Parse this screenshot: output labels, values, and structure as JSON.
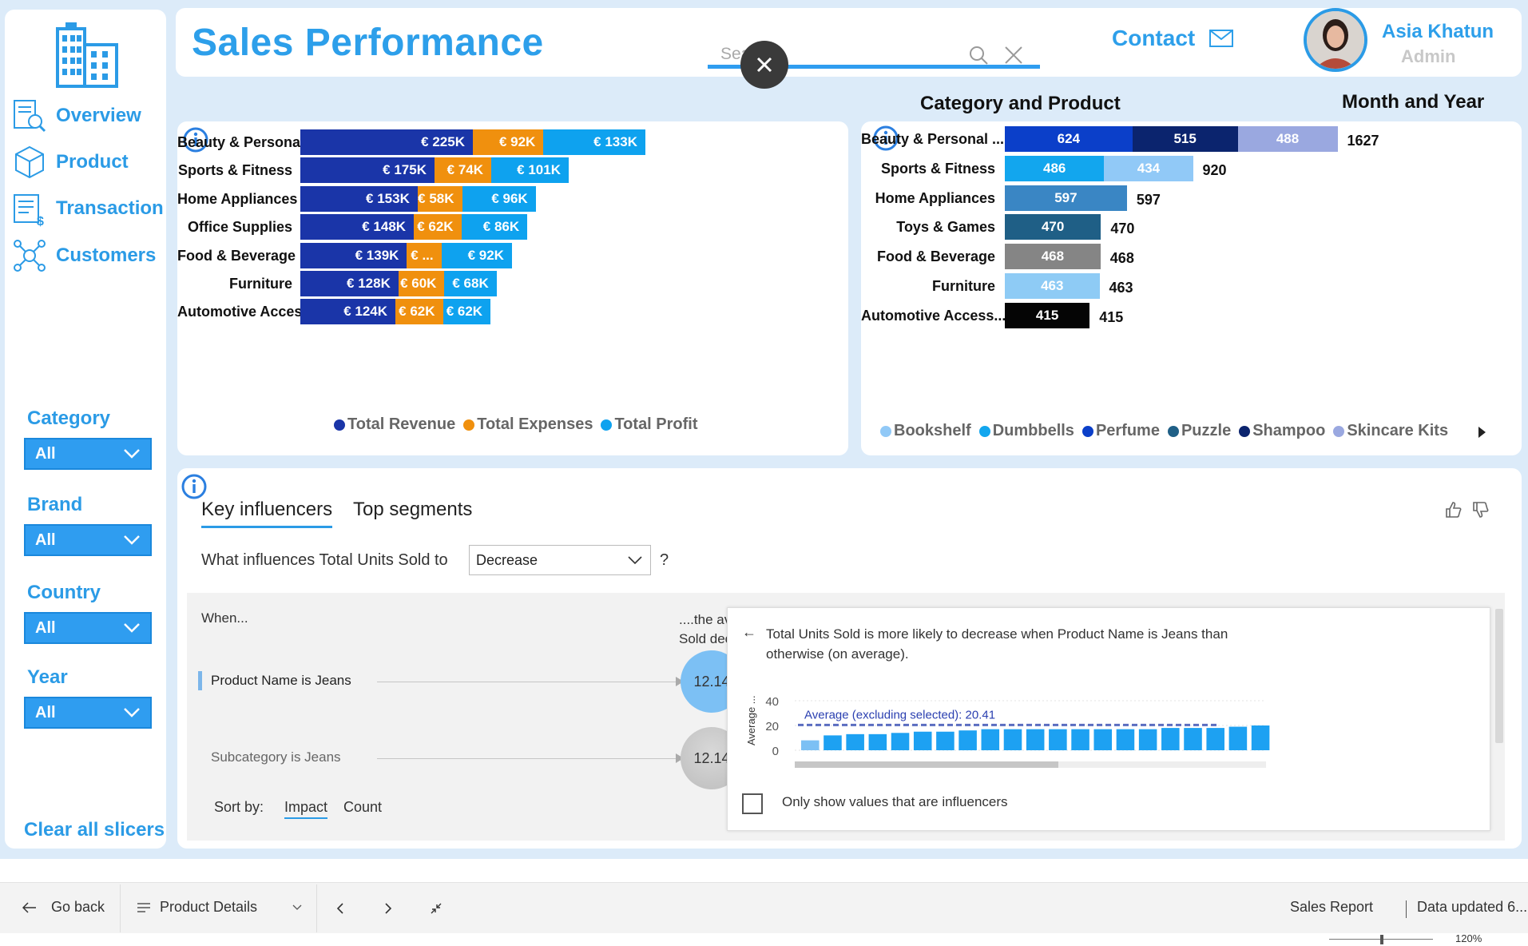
{
  "header": {
    "title": "Sales Performance",
    "search_placeholder": "Search",
    "contact_label": "Contact",
    "user_name": "Asia Khatun",
    "user_role": "Admin"
  },
  "nav": [
    {
      "label": "Overview",
      "icon": "report-search-icon"
    },
    {
      "label": "Product",
      "icon": "box-icon"
    },
    {
      "label": "Transaction",
      "icon": "invoice-icon"
    },
    {
      "label": "Customers",
      "icon": "network-icon"
    }
  ],
  "slicers": [
    {
      "label": "Category",
      "value": "All"
    },
    {
      "label": "Brand",
      "value": "All"
    },
    {
      "label": "Country",
      "value": "All"
    },
    {
      "label": "Year",
      "value": "All"
    }
  ],
  "clear_all_label": "Clear all slicers",
  "section_titles": {
    "category_product": "Category and Product",
    "month_year": "Month and Year"
  },
  "colors": {
    "brand_blue": "#2d9fea",
    "revenue": "#1a35a8",
    "expenses": "#f0900e",
    "profit": "#0ea2ef",
    "bookshelf": "#91c9f7",
    "dumbbells": "#12a6ee",
    "perfume": "#0b3fc9",
    "puzzle": "#1f5f86",
    "shampoo": "#0b246e",
    "skincare": "#9aa8e0"
  },
  "chart_data": [
    {
      "type": "bar",
      "orientation": "horizontal-stacked",
      "categories": [
        "Beauty & Personal ...",
        "Sports & Fitness",
        "Home Appliances",
        "Office Supplies",
        "Food & Beverage",
        "Furniture",
        "Automotive Access..."
      ],
      "series": [
        {
          "name": "Total Revenue",
          "values": [
            225,
            175,
            153,
            148,
            139,
            128,
            124
          ],
          "labels": [
            "€ 225K",
            "€ 175K",
            "€ 153K",
            "€ 148K",
            "€ 139K",
            "€ 128K",
            "€ 124K"
          ]
        },
        {
          "name": "Total Expenses",
          "values": [
            92,
            74,
            58,
            62,
            45,
            60,
            62
          ],
          "labels": [
            "€ 92K",
            "€ 74K",
            "€ 58K",
            "€ 62K",
            "€ ...",
            "€ 60K",
            "€ 62K"
          ]
        },
        {
          "name": "Total Profit",
          "values": [
            133,
            101,
            96,
            86,
            92,
            68,
            62
          ],
          "labels": [
            "€ 133K",
            "€ 101K",
            "€ 96K",
            "€ 86K",
            "€ 92K",
            "€ 68K",
            "€ 62K"
          ]
        }
      ],
      "unit": "€ K"
    },
    {
      "type": "bar",
      "orientation": "horizontal-stacked",
      "categories": [
        "Beauty & Personal ...",
        "Sports & Fitness",
        "Home Appliances",
        "Toys & Games",
        "Food & Beverage",
        "Furniture",
        "Automotive Access..."
      ],
      "rows": [
        {
          "segments": [
            {
              "value": 624,
              "product": "Perfume"
            },
            {
              "value": 515,
              "product": "Shampoo"
            },
            {
              "value": 488,
              "product": "Skincare Kits"
            }
          ],
          "total": 1627
        },
        {
          "segments": [
            {
              "value": 486,
              "product": "Dumbbells"
            },
            {
              "value": 434,
              "product": "Bookshelf"
            }
          ],
          "total": 920
        },
        {
          "segments": [
            {
              "value": 597,
              "product": "unlisted"
            }
          ],
          "total": 597
        },
        {
          "segments": [
            {
              "value": 470,
              "product": "Puzzle"
            }
          ],
          "total": 470
        },
        {
          "segments": [
            {
              "value": 468,
              "product": "unlisted"
            }
          ],
          "total": 468
        },
        {
          "segments": [
            {
              "value": 463,
              "product": "unlisted"
            }
          ],
          "total": 463
        },
        {
          "segments": [
            {
              "value": 415,
              "product": "unlisted"
            }
          ],
          "total": 415
        }
      ],
      "legend": [
        "Bookshelf",
        "Dumbbells",
        "Perfume",
        "Puzzle",
        "Shampoo",
        "Skincare Kits"
      ]
    },
    {
      "type": "bar",
      "values_note": "",
      "ylim": [
        0,
        40
      ],
      "yticks": [
        0,
        20,
        40
      ],
      "ylabel": "Average ...",
      "reference_line": {
        "label": "Average (excluding selected): 20.41",
        "value": 20.41
      },
      "values": [
        8,
        12,
        13,
        13,
        14,
        15,
        15,
        16,
        17,
        17,
        17,
        17,
        17,
        17,
        17,
        17,
        18,
        18,
        18,
        19,
        20
      ]
    }
  ],
  "key_influencers": {
    "tabs": [
      "Key influencers",
      "Top segments"
    ],
    "question": "What influences Total Units Sold to",
    "dropdown_value": "Decrease",
    "question_mark": "?",
    "when_label": "When...",
    "avg_label": "....the average of Total Units Sold decreases by",
    "rows": [
      {
        "label": "Product Name is Jeans",
        "value": "12.14"
      },
      {
        "label": "Subcategory is Jeans",
        "value": "12.14"
      }
    ],
    "sort_by_label": "Sort by:",
    "sort_options": [
      "Impact",
      "Count"
    ],
    "detail_text": "Total Units Sold is more likely to decrease when Product Name is Jeans than otherwise (on average).",
    "checkbox_label": "Only show values that are influencers"
  },
  "bottom_bar": {
    "go_back": "Go back",
    "page": "Product Details",
    "report_name": "Sales Report",
    "data_updated": "Data updated 6...",
    "zoom": "120%"
  }
}
